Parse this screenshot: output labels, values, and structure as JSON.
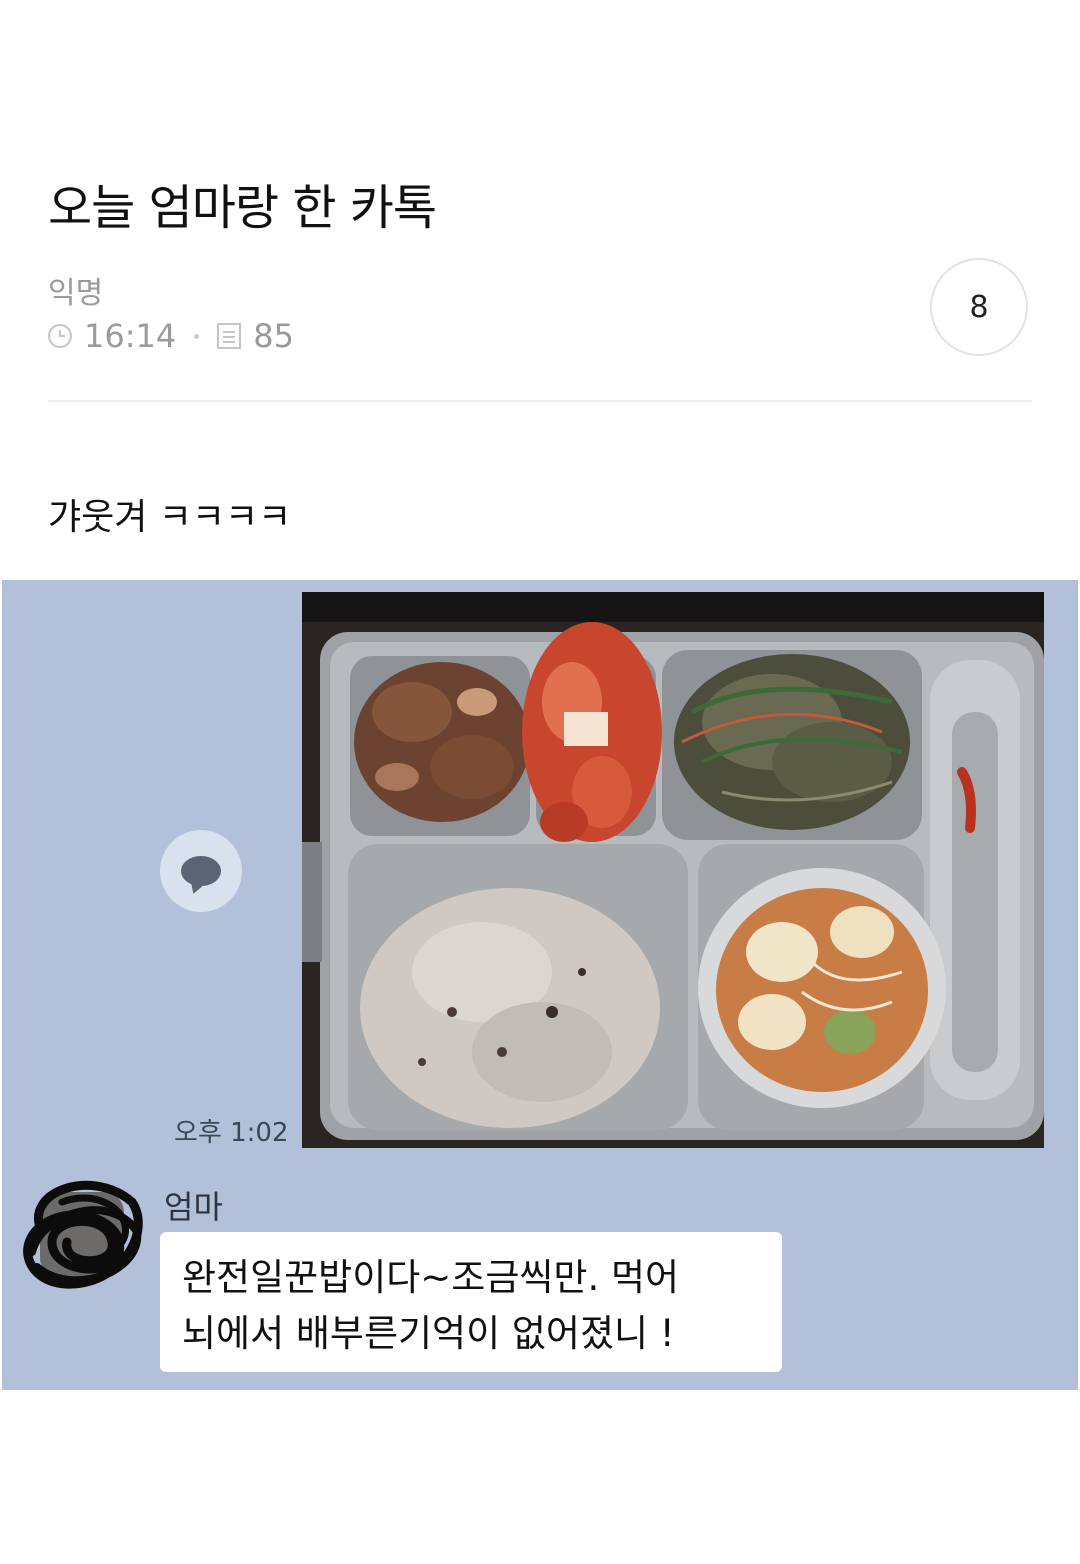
{
  "post": {
    "title": "오늘 엄마랑 한 카톡",
    "author": "익명",
    "time": "16:14",
    "views": "85",
    "comment_count": "8",
    "body": "갸웃겨 ㅋㅋㅋㅋ"
  },
  "chat": {
    "photo_description_icon": "school-lunch-tray-photo",
    "message_time": "오후 1:02",
    "sender": "엄마",
    "reply_lines": [
      "완전일꾼밥이다~조금씩만. 먹어",
      "뇌에서 배부른기억이 없어졌니 !"
    ]
  },
  "colors": {
    "chat_background": "#b2c1d9",
    "meta_gray": "#9a9a9a"
  }
}
